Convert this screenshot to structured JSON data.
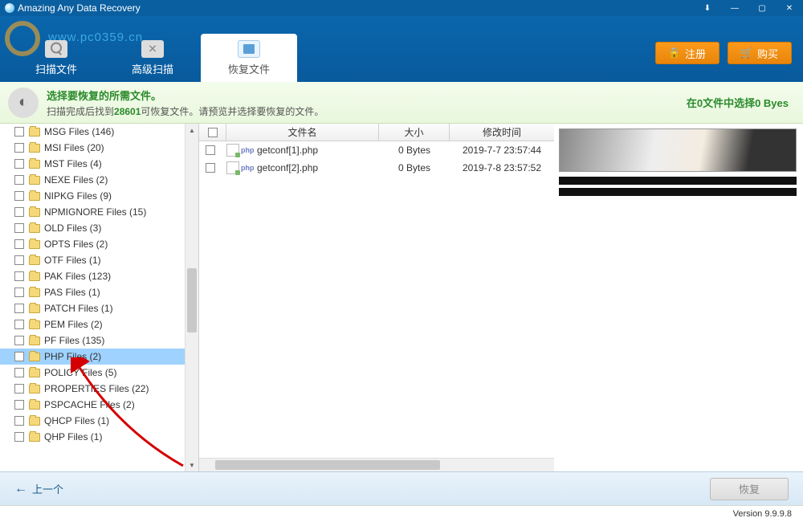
{
  "title": "Amazing Any Data Recovery",
  "watermark_url": "www.pc0359.cn",
  "header_buttons": {
    "register": "注册",
    "buy": "购买"
  },
  "tabs": {
    "scan": "扫描文件",
    "advanced": "高级扫描",
    "recover": "恢复文件"
  },
  "banner": {
    "title": "选择要恢复的所需文件。",
    "prefix": "扫描完成后找到",
    "count": "28601",
    "suffix": "可恢复文件。请预览并选择要恢复的文件。",
    "right": "在0文件中选择0 Byes"
  },
  "tree": [
    "MSG Files (146)",
    "MSI Files (20)",
    "MST Files (4)",
    "NEXE Files (2)",
    "NIPKG Files (9)",
    "NPMIGNORE Files (15)",
    "OLD Files (3)",
    "OPTS Files (2)",
    "OTF Files (1)",
    "PAK Files (123)",
    "PAS Files (1)",
    "PATCH Files (1)",
    "PEM Files (2)",
    "PF Files (135)",
    "PHP Files (2)",
    "POLICY Files (5)",
    "PROPERTIES Files (22)",
    "PSPCACHE Files (2)",
    "QHCP Files (1)",
    "QHP Files (1)"
  ],
  "tree_selected_index": 14,
  "columns": {
    "name": "文件名",
    "size": "大小",
    "date": "修改时间"
  },
  "rows": [
    {
      "name": "getconf[1].php",
      "size": "0 Bytes",
      "date": "2019-7-7 23:57:44"
    },
    {
      "name": "getconf[2].php",
      "size": "0 Bytes",
      "date": "2019-7-8 23:57:52"
    }
  ],
  "footer": {
    "back": "上一个",
    "recover": "恢复"
  },
  "version": "Version 9.9.9.8"
}
